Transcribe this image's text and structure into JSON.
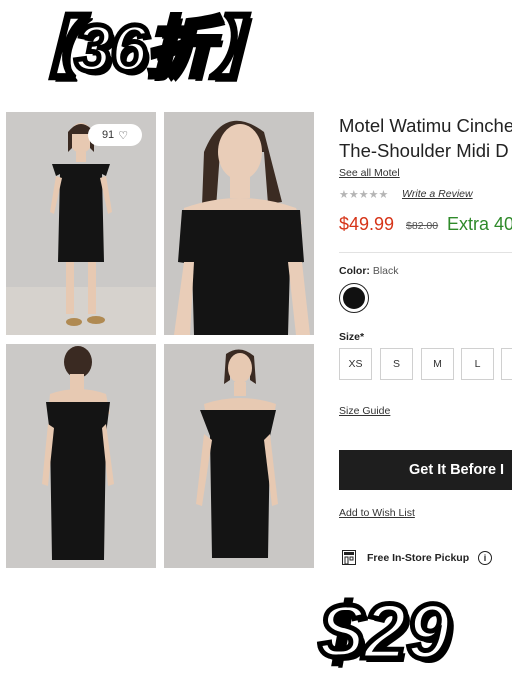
{
  "overlay": {
    "banner": "【36折】",
    "price_sticker": "$29"
  },
  "gallery": {
    "favorites_count": "91",
    "photos": [
      {
        "alt": "model front full length in black off-shoulder dress"
      },
      {
        "alt": "model close-up front of ruched bodice"
      },
      {
        "alt": "model back view"
      },
      {
        "alt": "model front three-quarter view"
      }
    ]
  },
  "product": {
    "title_line1": "Motel Watimu Cinche",
    "title_line2": "The-Shoulder Midi D",
    "see_all": "See all Motel",
    "stars": "★★★★★",
    "rating": 0,
    "write_review": "Write a Review",
    "price_sale": "$49.99",
    "price_original": "$82.00",
    "price_extra": "Extra 40",
    "color_label": "Color:",
    "color_value": "Black",
    "size_label": "Size*",
    "sizes": [
      "XS",
      "S",
      "M",
      "L",
      "X"
    ],
    "size_guide": "Size Guide",
    "cta_label": "Get It Before I",
    "wishlist": "Add to Wish List",
    "pickup_label": "Free In-Store Pickup",
    "info_glyph": "i"
  },
  "colors": {
    "sale": "#d63418",
    "extra": "#2f8a2a",
    "cta_bg": "#1e1e1e",
    "dress": "#111111",
    "photo_bg": "#c9c7c5"
  }
}
